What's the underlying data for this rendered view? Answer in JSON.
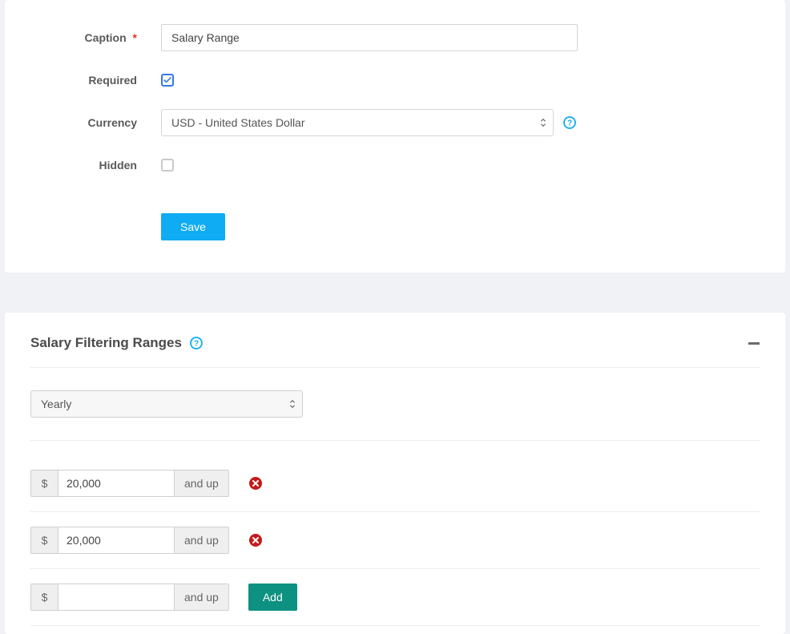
{
  "form": {
    "caption_label": "Caption",
    "caption_value": "Salary Range",
    "required_label": "Required",
    "required_checked": true,
    "currency_label": "Currency",
    "currency_value": "USD - United States Dollar",
    "hidden_label": "Hidden",
    "hidden_checked": false,
    "save_label": "Save"
  },
  "filtering": {
    "title": "Salary Filtering Ranges",
    "period_value": "Yearly",
    "currency_symbol": "$",
    "and_up_label": "and up",
    "rows": [
      {
        "value": "20,000"
      },
      {
        "value": "20,000"
      },
      {
        "value": ""
      }
    ],
    "add_label": "Add"
  }
}
